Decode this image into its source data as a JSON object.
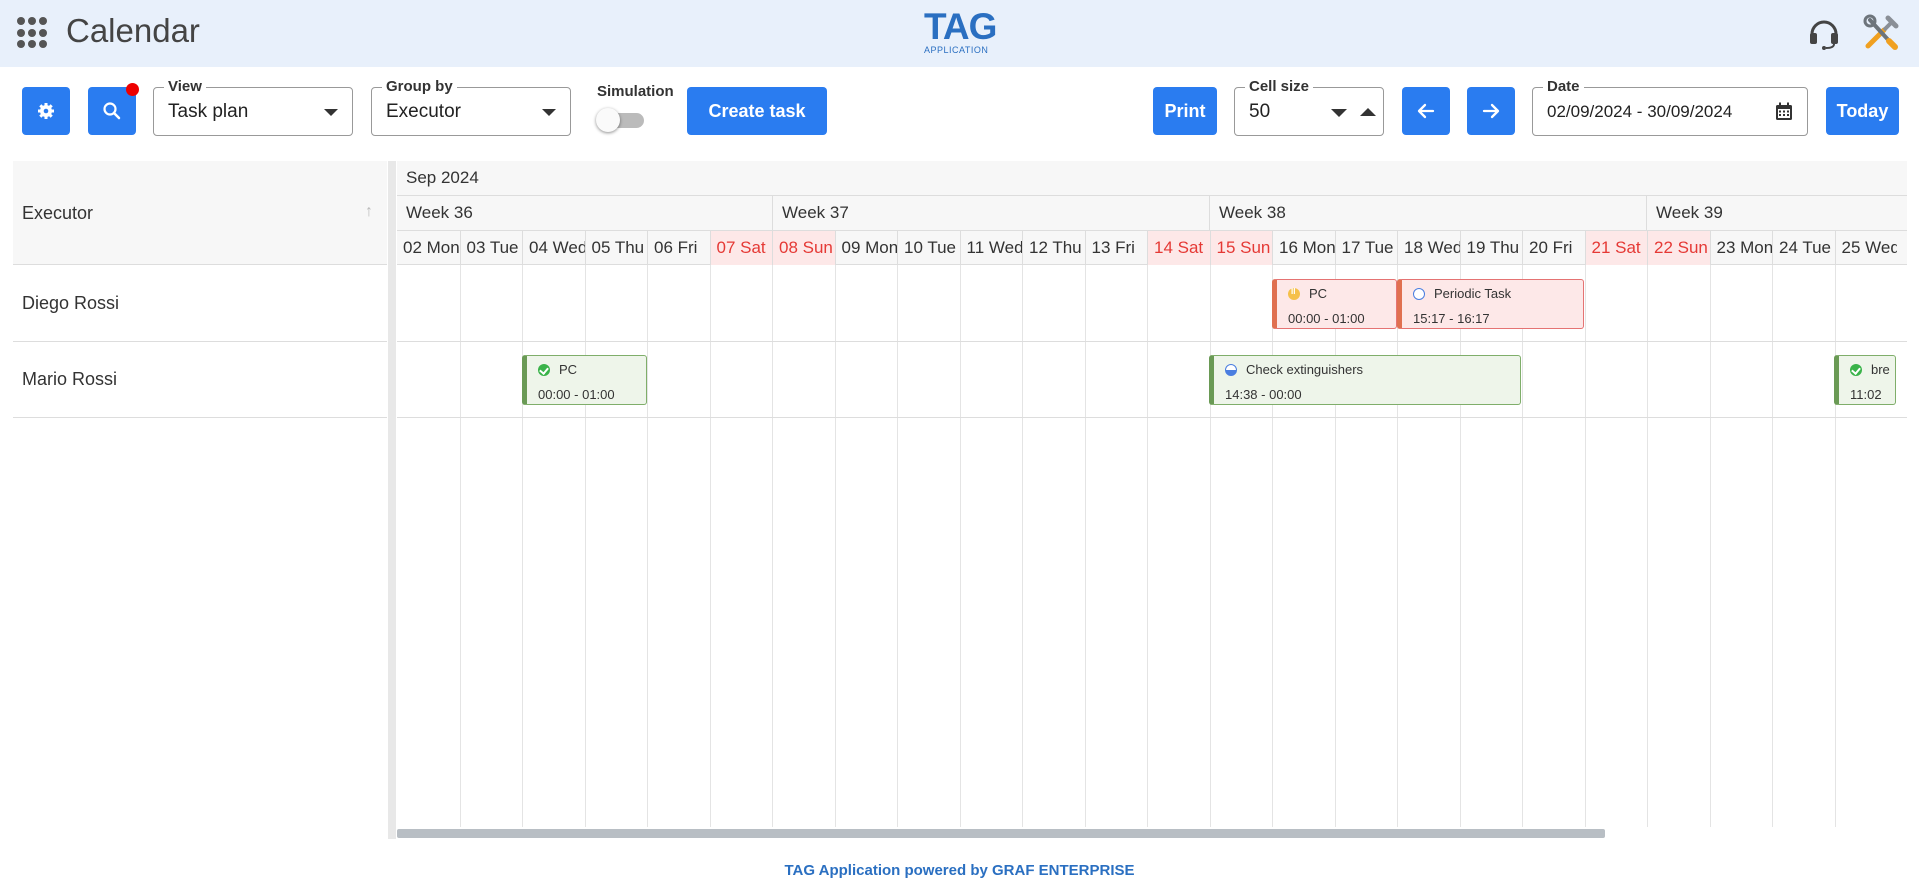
{
  "header": {
    "title": "Calendar",
    "logo_main": "TAG",
    "logo_sub": "APPLICATION"
  },
  "toolbar": {
    "view_label": "View",
    "view_value": "Task plan",
    "group_label": "Group by",
    "group_value": "Executor",
    "simulation_label": "Simulation",
    "simulation_on": false,
    "create_task_label": "Create task",
    "print_label": "Print",
    "cell_size_label": "Cell size",
    "cell_size_value": "50",
    "date_label": "Date",
    "date_value": "02/09/2024 - 30/09/2024",
    "today_label": "Today",
    "accent_color": "#2a7cf0"
  },
  "grid": {
    "executor_header": "Executor",
    "month": "Sep 2024",
    "weeks": [
      "Week 36",
      "Week 37",
      "Week 38",
      "Week 39"
    ],
    "days": [
      {
        "label": "02 Mon",
        "weekend": false
      },
      {
        "label": "03 Tue",
        "weekend": false
      },
      {
        "label": "04 Wed",
        "weekend": false
      },
      {
        "label": "05 Thu",
        "weekend": false
      },
      {
        "label": "06 Fri",
        "weekend": false
      },
      {
        "label": "07 Sat",
        "weekend": true
      },
      {
        "label": "08 Sun",
        "weekend": true
      },
      {
        "label": "09 Mon",
        "weekend": false
      },
      {
        "label": "10 Tue",
        "weekend": false
      },
      {
        "label": "11 Wed",
        "weekend": false
      },
      {
        "label": "12 Thu",
        "weekend": false
      },
      {
        "label": "13 Fri",
        "weekend": false
      },
      {
        "label": "14 Sat",
        "weekend": true
      },
      {
        "label": "15 Sun",
        "weekend": true
      },
      {
        "label": "16 Mon",
        "weekend": false
      },
      {
        "label": "17 Tue",
        "weekend": false
      },
      {
        "label": "18 Wed",
        "weekend": false
      },
      {
        "label": "19 Thu",
        "weekend": false
      },
      {
        "label": "20 Fri",
        "weekend": false
      },
      {
        "label": "21 Sat",
        "weekend": true
      },
      {
        "label": "22 Sun",
        "weekend": true
      },
      {
        "label": "23 Mon",
        "weekend": false
      },
      {
        "label": "24 Tue",
        "weekend": false
      },
      {
        "label": "25 Wed",
        "weekend": false
      }
    ],
    "executors": [
      "Diego Rossi",
      "Mario Rossi"
    ],
    "tasks": [
      {
        "name": "PC",
        "time": "00:00 - 01:00",
        "executor": "Diego Rossi",
        "status": "paused",
        "color": "red"
      },
      {
        "name": "Periodic Task",
        "time": "15:17 - 16:17",
        "executor": "Diego Rossi",
        "status": "open",
        "color": "red"
      },
      {
        "name": "PC",
        "time": "00:00 - 01:00",
        "executor": "Mario Rossi",
        "status": "done",
        "color": "green"
      },
      {
        "name": "Check extinguishers",
        "time": "14:38 - 00:00",
        "executor": "Mario Rossi",
        "status": "in-progress",
        "color": "green"
      },
      {
        "name": "bre",
        "time": "11:02",
        "executor": "Mario Rossi",
        "status": "done",
        "color": "green"
      }
    ]
  },
  "footer": "TAG Application powered by GRAF ENTERPRISE"
}
